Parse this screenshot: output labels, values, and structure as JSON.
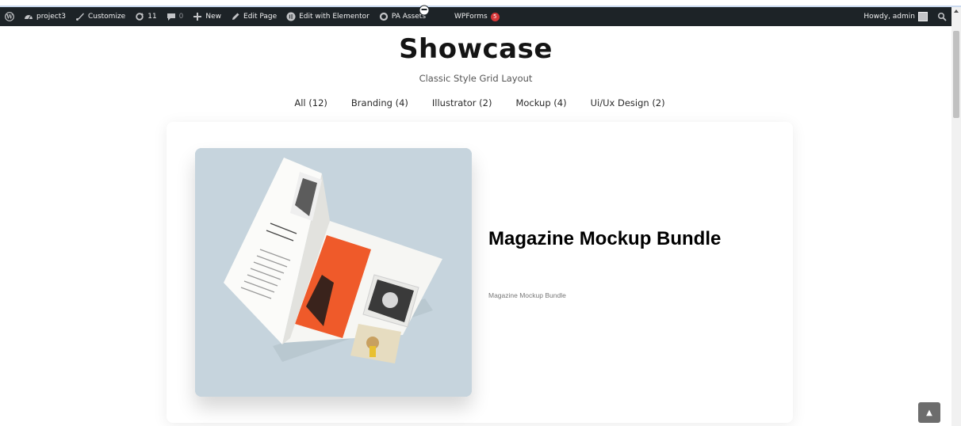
{
  "adminbar": {
    "site_name": "project3",
    "customize": "Customize",
    "updates_count": "11",
    "comments_count": "0",
    "new_label": "New",
    "edit_page": "Edit Page",
    "edit_elementor": "Edit with Elementor",
    "pa_assets": "PA Assets",
    "wpforms": "WPForms",
    "wpforms_badge": "5",
    "howdy": "Howdy, admin"
  },
  "page": {
    "title": "Showcase",
    "subtitle": "Classic Style Grid Layout"
  },
  "filters": [
    {
      "label": "All (12)"
    },
    {
      "label": "Branding (4)"
    },
    {
      "label": "Illustrator (2)"
    },
    {
      "label": "Mockup (4)"
    },
    {
      "label": "Ui/Ux Design (2)"
    }
  ],
  "card": {
    "title": "Magazine Mockup Bundle",
    "description": "Magazine Mockup Bundle"
  },
  "colors": {
    "adminbar_bg": "#1d2327",
    "badge": "#d63638",
    "orange": "#ef5a2a"
  }
}
